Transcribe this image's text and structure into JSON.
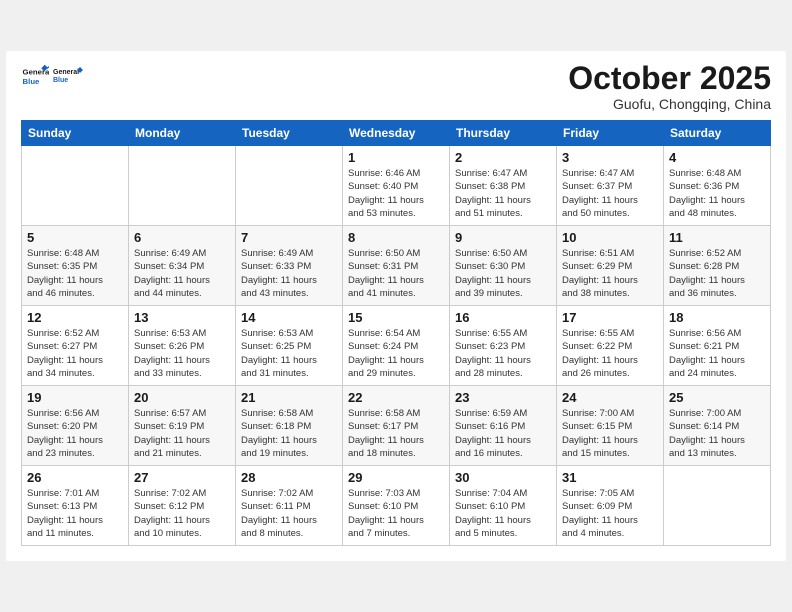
{
  "header": {
    "logo_general": "General",
    "logo_blue": "Blue",
    "month_year": "October 2025",
    "location": "Guofu, Chongqing, China"
  },
  "weekdays": [
    "Sunday",
    "Monday",
    "Tuesday",
    "Wednesday",
    "Thursday",
    "Friday",
    "Saturday"
  ],
  "weeks": [
    {
      "rowClass": "row-week1",
      "days": [
        {
          "date": "",
          "info": ""
        },
        {
          "date": "",
          "info": ""
        },
        {
          "date": "",
          "info": ""
        },
        {
          "date": "1",
          "info": "Sunrise: 6:46 AM\nSunset: 6:40 PM\nDaylight: 11 hours\nand 53 minutes."
        },
        {
          "date": "2",
          "info": "Sunrise: 6:47 AM\nSunset: 6:38 PM\nDaylight: 11 hours\nand 51 minutes."
        },
        {
          "date": "3",
          "info": "Sunrise: 6:47 AM\nSunset: 6:37 PM\nDaylight: 11 hours\nand 50 minutes."
        },
        {
          "date": "4",
          "info": "Sunrise: 6:48 AM\nSunset: 6:36 PM\nDaylight: 11 hours\nand 48 minutes."
        }
      ]
    },
    {
      "rowClass": "row-week2",
      "days": [
        {
          "date": "5",
          "info": "Sunrise: 6:48 AM\nSunset: 6:35 PM\nDaylight: 11 hours\nand 46 minutes."
        },
        {
          "date": "6",
          "info": "Sunrise: 6:49 AM\nSunset: 6:34 PM\nDaylight: 11 hours\nand 44 minutes."
        },
        {
          "date": "7",
          "info": "Sunrise: 6:49 AM\nSunset: 6:33 PM\nDaylight: 11 hours\nand 43 minutes."
        },
        {
          "date": "8",
          "info": "Sunrise: 6:50 AM\nSunset: 6:31 PM\nDaylight: 11 hours\nand 41 minutes."
        },
        {
          "date": "9",
          "info": "Sunrise: 6:50 AM\nSunset: 6:30 PM\nDaylight: 11 hours\nand 39 minutes."
        },
        {
          "date": "10",
          "info": "Sunrise: 6:51 AM\nSunset: 6:29 PM\nDaylight: 11 hours\nand 38 minutes."
        },
        {
          "date": "11",
          "info": "Sunrise: 6:52 AM\nSunset: 6:28 PM\nDaylight: 11 hours\nand 36 minutes."
        }
      ]
    },
    {
      "rowClass": "row-week3",
      "days": [
        {
          "date": "12",
          "info": "Sunrise: 6:52 AM\nSunset: 6:27 PM\nDaylight: 11 hours\nand 34 minutes."
        },
        {
          "date": "13",
          "info": "Sunrise: 6:53 AM\nSunset: 6:26 PM\nDaylight: 11 hours\nand 33 minutes."
        },
        {
          "date": "14",
          "info": "Sunrise: 6:53 AM\nSunset: 6:25 PM\nDaylight: 11 hours\nand 31 minutes."
        },
        {
          "date": "15",
          "info": "Sunrise: 6:54 AM\nSunset: 6:24 PM\nDaylight: 11 hours\nand 29 minutes."
        },
        {
          "date": "16",
          "info": "Sunrise: 6:55 AM\nSunset: 6:23 PM\nDaylight: 11 hours\nand 28 minutes."
        },
        {
          "date": "17",
          "info": "Sunrise: 6:55 AM\nSunset: 6:22 PM\nDaylight: 11 hours\nand 26 minutes."
        },
        {
          "date": "18",
          "info": "Sunrise: 6:56 AM\nSunset: 6:21 PM\nDaylight: 11 hours\nand 24 minutes."
        }
      ]
    },
    {
      "rowClass": "row-week4",
      "days": [
        {
          "date": "19",
          "info": "Sunrise: 6:56 AM\nSunset: 6:20 PM\nDaylight: 11 hours\nand 23 minutes."
        },
        {
          "date": "20",
          "info": "Sunrise: 6:57 AM\nSunset: 6:19 PM\nDaylight: 11 hours\nand 21 minutes."
        },
        {
          "date": "21",
          "info": "Sunrise: 6:58 AM\nSunset: 6:18 PM\nDaylight: 11 hours\nand 19 minutes."
        },
        {
          "date": "22",
          "info": "Sunrise: 6:58 AM\nSunset: 6:17 PM\nDaylight: 11 hours\nand 18 minutes."
        },
        {
          "date": "23",
          "info": "Sunrise: 6:59 AM\nSunset: 6:16 PM\nDaylight: 11 hours\nand 16 minutes."
        },
        {
          "date": "24",
          "info": "Sunrise: 7:00 AM\nSunset: 6:15 PM\nDaylight: 11 hours\nand 15 minutes."
        },
        {
          "date": "25",
          "info": "Sunrise: 7:00 AM\nSunset: 6:14 PM\nDaylight: 11 hours\nand 13 minutes."
        }
      ]
    },
    {
      "rowClass": "row-week5",
      "days": [
        {
          "date": "26",
          "info": "Sunrise: 7:01 AM\nSunset: 6:13 PM\nDaylight: 11 hours\nand 11 minutes."
        },
        {
          "date": "27",
          "info": "Sunrise: 7:02 AM\nSunset: 6:12 PM\nDaylight: 11 hours\nand 10 minutes."
        },
        {
          "date": "28",
          "info": "Sunrise: 7:02 AM\nSunset: 6:11 PM\nDaylight: 11 hours\nand 8 minutes."
        },
        {
          "date": "29",
          "info": "Sunrise: 7:03 AM\nSunset: 6:10 PM\nDaylight: 11 hours\nand 7 minutes."
        },
        {
          "date": "30",
          "info": "Sunrise: 7:04 AM\nSunset: 6:10 PM\nDaylight: 11 hours\nand 5 minutes."
        },
        {
          "date": "31",
          "info": "Sunrise: 7:05 AM\nSunset: 6:09 PM\nDaylight: 11 hours\nand 4 minutes."
        },
        {
          "date": "",
          "info": ""
        }
      ]
    }
  ]
}
